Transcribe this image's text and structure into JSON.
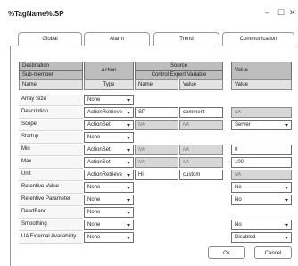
{
  "window": {
    "title": "%TagName%.SP",
    "minimize": "–",
    "maximize": "☐",
    "close": "✕"
  },
  "tabs": [
    "Global",
    "Alarm",
    "Trend",
    "Communication"
  ],
  "headers": {
    "destination": "Destination",
    "sub_member": "Sub-member",
    "name": "Name",
    "action": "Action",
    "type": "Type",
    "source": "Source",
    "control_expert_variable": "Control Expert Variable",
    "source_name": "Name",
    "source_value": "Value",
    "value": "Value",
    "value_sub": "Value"
  },
  "rows": [
    {
      "name": "Array Size",
      "type": "None",
      "src_name": "",
      "src_value": "",
      "value": ""
    },
    {
      "name": "Description",
      "type": "ActionRetrieve",
      "src_name": "SP",
      "src_value": "comment",
      "value": "NA"
    },
    {
      "name": "Scope",
      "type": "ActionSet",
      "src_name": "NA",
      "src_value": "NA",
      "value": "Server"
    },
    {
      "name": "Startup",
      "type": "None",
      "src_name": "",
      "src_value": "",
      "value": ""
    },
    {
      "name": "Min",
      "type": "ActionSet",
      "src_name": "NA",
      "src_value": "NA",
      "value": "0"
    },
    {
      "name": "Max",
      "type": "ActionSet",
      "src_name": "NA",
      "src_value": "NA",
      "value": "100"
    },
    {
      "name": "Unit",
      "type": "ActionRetrieve",
      "src_name": "Hi",
      "src_value": "custom",
      "value": "NA"
    },
    {
      "name": "Retentive Value",
      "type": "None",
      "src_name": "",
      "src_value": "",
      "value": "No"
    },
    {
      "name": "Retentive Parameter",
      "type": "None",
      "src_name": "",
      "src_value": "",
      "value": "No"
    },
    {
      "name": "DeadBand",
      "type": "None",
      "src_name": "",
      "src_value": "",
      "value": ""
    },
    {
      "name": "Smoothing",
      "type": "None",
      "src_name": "",
      "src_value": "",
      "value": "No"
    },
    {
      "name": "UA External Availability",
      "type": "None",
      "src_name": "",
      "src_value": "",
      "value": "Disabled"
    }
  ],
  "buttons": {
    "ok": "Ok",
    "cancel": "Cancel"
  }
}
